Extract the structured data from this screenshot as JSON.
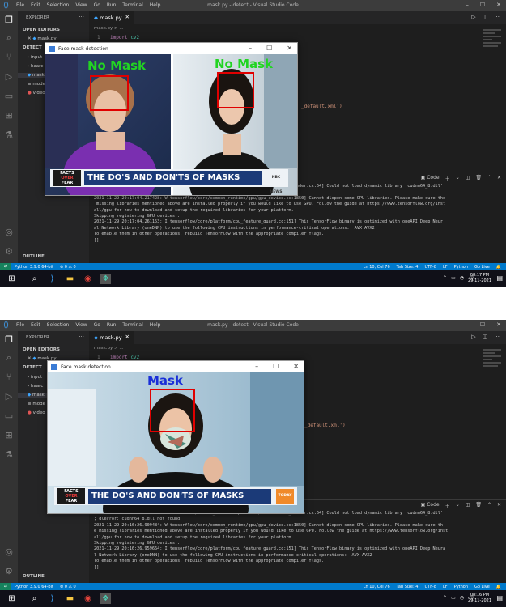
{
  "vscode": {
    "menu": [
      "File",
      "Edit",
      "Selection",
      "View",
      "Go",
      "Run",
      "Terminal",
      "Help"
    ],
    "window_title": "mask.py - detect - Visual Studio Code",
    "explorer_label": "EXPLORER",
    "open_editors": "OPEN EDITORS",
    "open_file": "mask.py",
    "detect_folder": "DETECT",
    "outline": "OUTLINE",
    "tree": [
      "input",
      "haarc",
      "mask",
      "mode",
      "video"
    ],
    "tab_label": "mask.py",
    "breadcrumb": "mask.py > ...",
    "code_line_no": "1",
    "code_keyword": "import",
    "code_module": "cv2",
    "code_fragment": "_default.xml')",
    "terminal_label": "Code"
  },
  "screens": [
    {
      "terminal_text": "2021-11-29 20:17:04.195960: W tensorflow/stream_executor/platform/default/dso_loader.cc:64] Could not load dynamic library 'cudnn64_8.dll';\n dlerror: cudnn64_8.dll not found\n2021-11-29 20:17:04.217428: W tensorflow/core/common_runtime/gpu/gpu_device.cc:1850] Cannot dlopen some GPU libraries. Please make sure the\n missing libraries mentioned above are installed properly if you would like to use GPU. Follow the guide at https://www.tensorflow.org/inst\nall/gpu for how to download and setup the required libraries for your platform.\nSkipping registering GPU devices...\n2021-11-29 20:17:04.261153: I tensorflow/core/platform/cpu_feature_guard.cc:151] This TensorFlow binary is optimized with oneAPI Deep Neur\nal Network Library (oneDNN) to use the following CPU instructions in performance-critical operations:  AVX AVX2\nTo enable them in other operations, rebuild TensorFlow with the appropriate compiler flags.\n[]",
      "status_left": [
        "Python 3.9.0 64-bit",
        "⊗ 0 ⚠ 0"
      ],
      "status_right": [
        "Ln 10, Col 76",
        "Tab Size: 4",
        "UTF-8",
        "LF",
        "Python",
        "Go Live"
      ],
      "clock_time": "08:17 PM",
      "clock_date": "29-11-2021",
      "window_title": "Face mask detection",
      "labels": [
        "No Mask",
        "No Mask"
      ],
      "banner_text": "THE DO'S AND DON'TS OF MASKS",
      "banner_logo": [
        "FACTS",
        "OVER",
        "FEAR"
      ],
      "banner_brand": "NBC NEWS"
    },
    {
      "terminal_text": "2021-11-29 20:16:26.885922: W tensorflow/stream_executor/platform/default/dso_loader.cc:64] Could not load dynamic library 'cudnn64_8.dll'\n; dlerror: cudnn64_8.dll not found\n2021-11-29 20:16:26.909484: W tensorflow/core/common_runtime/gpu/gpu_device.cc:1850] Cannot dlopen some GPU libraries. Please make sure th\ne missing libraries mentioned above are installed properly if you would like to use GPU. Follow the guide at https://www.tensorflow.org/inst\nall/gpu for how to download and setup the required libraries for your platform.\nSkipping registering GPU devices...\n2021-11-29 20:16:26.959664: I tensorflow/core/platform/cpu_feature_guard.cc:151] This TensorFlow binary is optimized with oneAPI Deep Neura\nl Network Library (oneDNN) to use the following CPU instructions in performance-critical operations:  AVX AVX2\nTo enable them in other operations, rebuild TensorFlow with the appropriate compiler flags.\n[]",
      "status_left": [
        "Python 3.9.0 64-bit",
        "⊗ 0 ⚠ 0"
      ],
      "status_right": [
        "Ln 10, Col 76",
        "Tab Size: 4",
        "UTF-8",
        "LF",
        "Python",
        "Go Live"
      ],
      "clock_time": "08:16 PM",
      "clock_date": "29-11-2021",
      "window_title": "Face mask detection",
      "labels": [
        "Mask"
      ],
      "banner_text": "THE DO'S AND DON'TS OF MASKS",
      "banner_logo": [
        "FACTS",
        "OVER",
        "FEAR"
      ],
      "banner_brand": "TODAY"
    }
  ],
  "colors": {
    "no_mask_label": "#22d422",
    "mask_label": "#1a2fd8",
    "face_box": "#e00000",
    "vscode_accent": "#007acc"
  },
  "icons": [
    "files-icon",
    "search-icon",
    "source-control-icon",
    "run-debug-icon",
    "extensions-icon",
    "account-icon",
    "settings-gear-icon"
  ]
}
